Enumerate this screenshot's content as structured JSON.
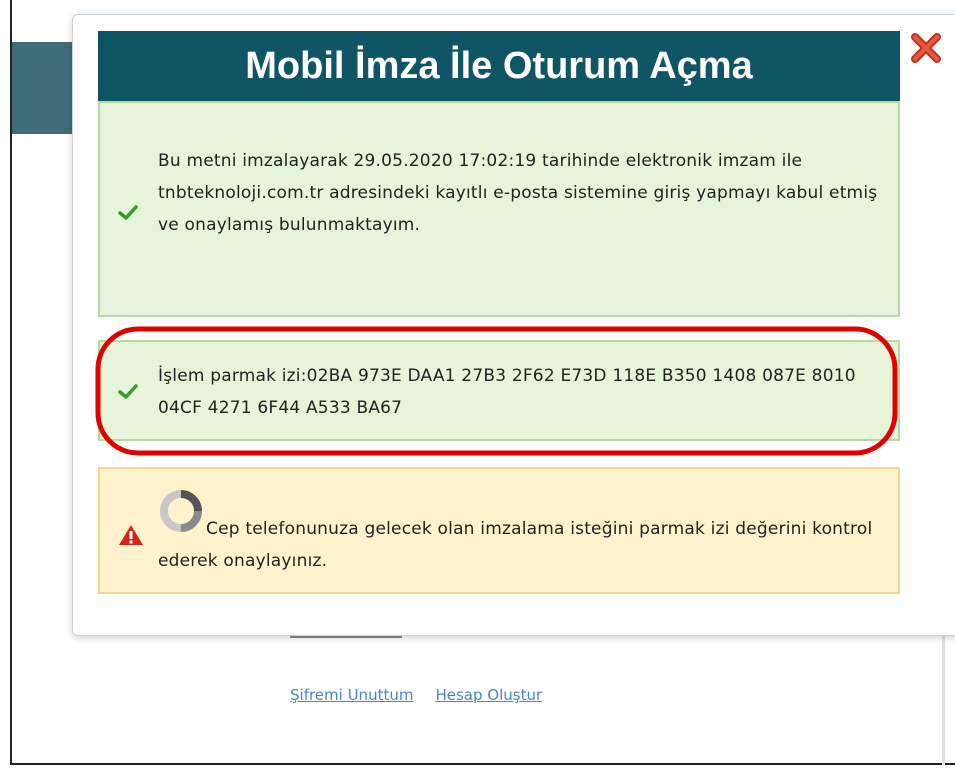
{
  "modal": {
    "title": "Mobil İmza İle Oturum Açma",
    "messages": {
      "consent": "Bu metni imzalayarak 29.05.2020 17:02:19 tarihinde elektronik imzam ile tnbteknoloji.com.tr adresindeki kayıtlı e-posta sistemine giriş yapmayı kabul etmiş ve onaylamış bulunmaktayım.",
      "fingerprint": "İşlem parmak izi:02BA 973E DAA1 27B3 2F62 E73D 118E B350 1408 087E 8010 04CF 4271 6F44 A533 BA67",
      "warning": "Cep telefonunuza gelecek olan imzalama isteğini parmak izi değerini kontrol ederek onaylayınız."
    },
    "icons": {
      "close": "close-icon",
      "check": "check-icon",
      "warning": "warning-icon",
      "spinner": "loading-spinner-icon"
    }
  },
  "links": {
    "forgot_password": "Şifremi Unuttum",
    "create_account": "Hesap Oluştur"
  },
  "colors": {
    "title_bar": "#0f5566",
    "success_bg": "#e6f5d9",
    "warning_bg": "#fff3cd",
    "highlight": "#e00000",
    "link": "#4a86c5"
  }
}
